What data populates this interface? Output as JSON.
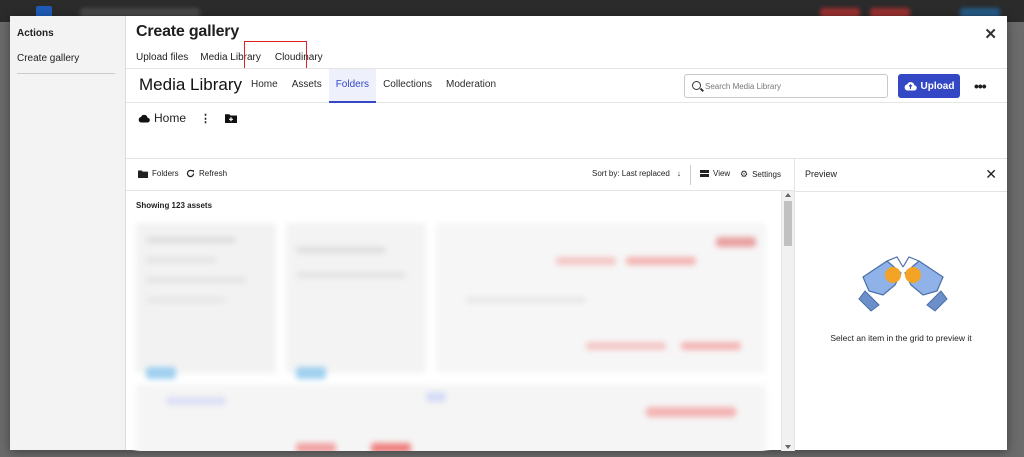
{
  "sidebar": {
    "actions_title": "Actions",
    "items": [
      {
        "label": "Create gallery"
      }
    ]
  },
  "modal": {
    "title": "Create gallery",
    "router_tabs": [
      {
        "label": "Upload files"
      },
      {
        "label": "Media Library"
      },
      {
        "label": "Cloudinary",
        "highlighted": true
      }
    ]
  },
  "media_library": {
    "title": "Media Library",
    "tabs": [
      {
        "label": "Home"
      },
      {
        "label": "Assets"
      },
      {
        "label": "Folders",
        "active": true
      },
      {
        "label": "Collections"
      },
      {
        "label": "Moderation"
      }
    ],
    "search_placeholder": "Search Media Library",
    "upload_label": "Upload",
    "breadcrumb": "Home",
    "toolbar": {
      "folders_label": "Folders",
      "refresh_label": "Refresh",
      "sort_label": "Sort by: Last replaced",
      "view_label": "View",
      "settings_label": "Settings"
    },
    "asset_count": "Showing 123 assets",
    "accent_color": "#3448c5"
  },
  "preview": {
    "title": "Preview",
    "hint": "Select an item in the grid to preview it"
  }
}
